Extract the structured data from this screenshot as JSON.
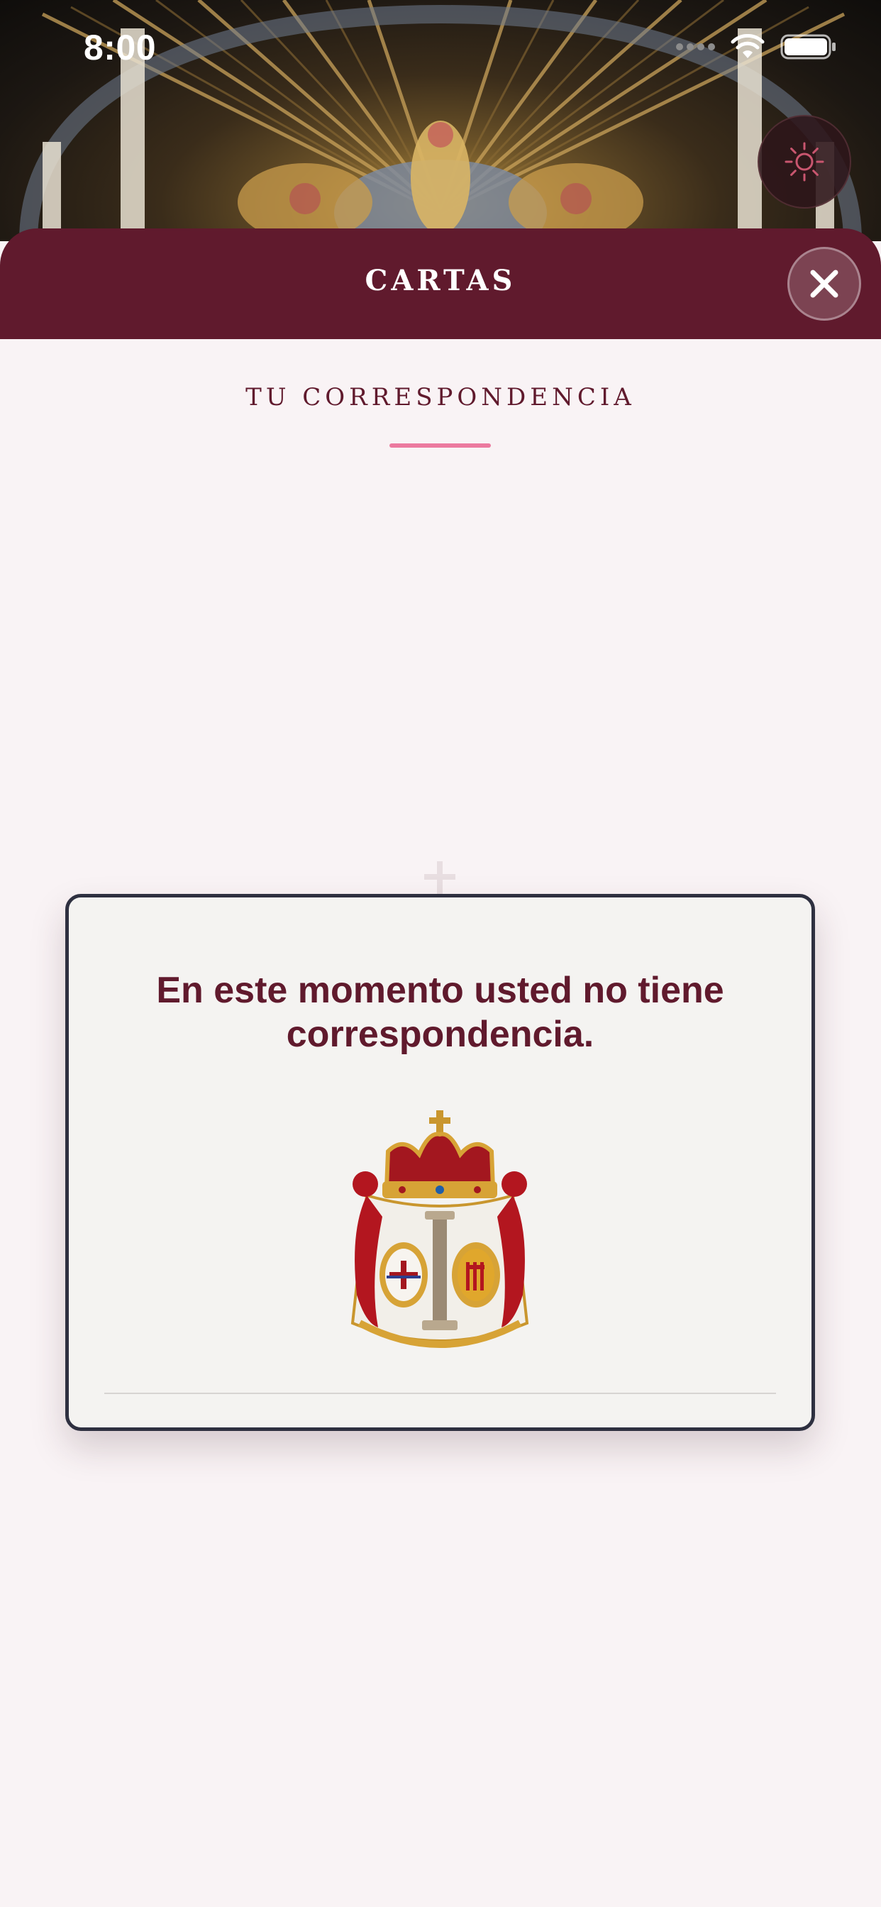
{
  "status_bar": {
    "time": "8:00",
    "icons": [
      "cellular-signal-icon",
      "wifi-icon",
      "battery-icon"
    ]
  },
  "theme_toggle": {
    "icon": "sun-icon"
  },
  "header": {
    "title": "CARTAS",
    "close_icon": "close-icon"
  },
  "section": {
    "heading": "TU CORRESPONDENCIA"
  },
  "empty_state": {
    "message": "En este momento usted no tiene correspondencia.",
    "image": "coat-of-arms-crest"
  },
  "colors": {
    "brand": "#601a2d",
    "accent": "#ec7a9f",
    "background": "#f9f3f5",
    "card_background": "#f4f3f1",
    "card_border": "#2e3040"
  }
}
